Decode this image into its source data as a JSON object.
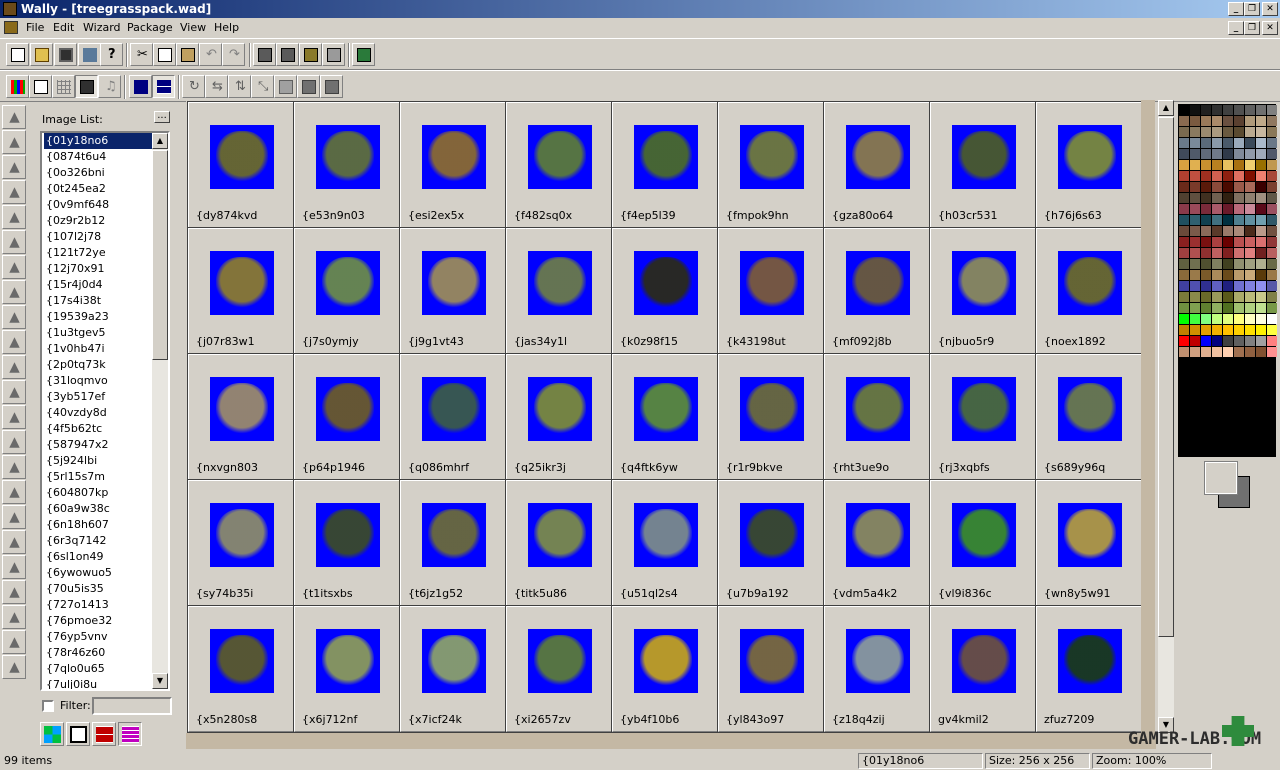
{
  "window": {
    "title": "Wally - [treegrasspack.wad]"
  },
  "menu": [
    "File",
    "Edit",
    "Wizard",
    "Package",
    "View",
    "Help"
  ],
  "list_panel": {
    "label": "Image List:",
    "more_label": "...",
    "filter_label": "Filter:",
    "filter_value": "",
    "items": [
      "{01y18no6",
      "{0874t6u4",
      "{0o326bni",
      "{0t245ea2",
      "{0v9mf648",
      "{0z9r2b12",
      "{107l2j78",
      "{121t72ye",
      "{12j70x91",
      "{15r4j0d4",
      "{17s4i38t",
      "{19539a23",
      "{1u3tgev5",
      "{1v0hb47i",
      "{2p0tq73k",
      "{31loqmvo",
      "{3yb517ef",
      "{40vzdy8d",
      "{4f5b62tc",
      "{587947x2",
      "{5j924lbi",
      "{5rl15s7m",
      "{604807kp",
      "{60a9w38c",
      "{6n18h607",
      "{6r3q7142",
      "{6sl1on49",
      "{6ywowuo5",
      "{70u5is35",
      "{727o1413",
      "{76pmoe32",
      "{76yp5vnv",
      "{78r46z60",
      "{7qlo0u65",
      "{7ulj0i8u"
    ],
    "selected_index": 0
  },
  "thumbnails": [
    {
      "name": "{dy874kvd",
      "color": "#6a6a2a"
    },
    {
      "name": "{e53n9n03",
      "color": "#5f6f3a"
    },
    {
      "name": "{esi2ex5x",
      "color": "#8a6a30"
    },
    {
      "name": "{f482sq0x",
      "color": "#5a7a3a"
    },
    {
      "name": "{f4ep5l39",
      "color": "#4a6a2a"
    },
    {
      "name": "{fmpok9hn",
      "color": "#6f7a3a"
    },
    {
      "name": "{gza80o64",
      "color": "#8a7a4a"
    },
    {
      "name": "{h03cr531",
      "color": "#4a5a2a"
    },
    {
      "name": "{h76j6s63",
      "color": "#7a8a3a"
    },
    {
      "name": "{j07r83w1",
      "color": "#8a7a30"
    },
    {
      "name": "{j7s0ymjy",
      "color": "#6a8a4a"
    },
    {
      "name": "{j9g1vt43",
      "color": "#9a8a5a"
    },
    {
      "name": "{jas34y1l",
      "color": "#6a7a4a"
    },
    {
      "name": "{k0z98f15",
      "color": "#2a2a1a"
    },
    {
      "name": "{k43198ut",
      "color": "#7a5a3a"
    },
    {
      "name": "{mf092j8b",
      "color": "#6a5a3a"
    },
    {
      "name": "{njbuo5r9",
      "color": "#8a8a5a"
    },
    {
      "name": "{noex1892",
      "color": "#6a6a2a"
    },
    {
      "name": "{nxvgn803",
      "color": "#9a8a6a"
    },
    {
      "name": "{p64p1946",
      "color": "#6a5a2a"
    },
    {
      "name": "{q086mhrf",
      "color": "#3a5a4a"
    },
    {
      "name": "{q25ikr3j",
      "color": "#7a8a3a"
    },
    {
      "name": "{q4ftk6yw",
      "color": "#5a8a3a"
    },
    {
      "name": "{r1r9bkve",
      "color": "#6a6a3a"
    },
    {
      "name": "{rht3ue9o",
      "color": "#6a7a3a"
    },
    {
      "name": "{rj3xqbfs",
      "color": "#4a6a3a"
    },
    {
      "name": "{s689y96q",
      "color": "#6a7a4a"
    },
    {
      "name": "{sy74b35i",
      "color": "#8a8a6a"
    },
    {
      "name": "{t1itsxbs",
      "color": "#3a4a2a"
    },
    {
      "name": "{t6jz1g52",
      "color": "#6a6a3a"
    },
    {
      "name": "{titk5u86",
      "color": "#7a8a4a"
    },
    {
      "name": "{u51ql2s4",
      "color": "#7a8a8a"
    },
    {
      "name": "{u7b9a192",
      "color": "#3a4a2a"
    },
    {
      "name": "{vdm5a4k2",
      "color": "#8a8a5a"
    },
    {
      "name": "{vl9i836c",
      "color": "#3a8a2a"
    },
    {
      "name": "{wn8y5w91",
      "color": "#b09a40"
    },
    {
      "name": "{x5n280s8",
      "color": "#5a5a2a"
    },
    {
      "name": "{x6j712nf",
      "color": "#8a9a5a"
    },
    {
      "name": "{x7icf24k",
      "color": "#8aa06a"
    },
    {
      "name": "{xi2657zv",
      "color": "#5a7a3a"
    },
    {
      "name": "{yb4f10b6",
      "color": "#c0a020"
    },
    {
      "name": "{yl843o97",
      "color": "#7a6a3a"
    },
    {
      "name": "{z18q4zij",
      "color": "#8a9a9a"
    },
    {
      "name": "gv4kmil2",
      "color": "#6a5040"
    },
    {
      "name": "zfuz7209",
      "color": "#1a3a1a"
    }
  ],
  "status": {
    "count": "99 items",
    "selected": "{01y18no6",
    "size": "Size: 256 x 256",
    "zoom": "Zoom: 100%"
  },
  "watermark": "GAMER-LAB.COM"
}
